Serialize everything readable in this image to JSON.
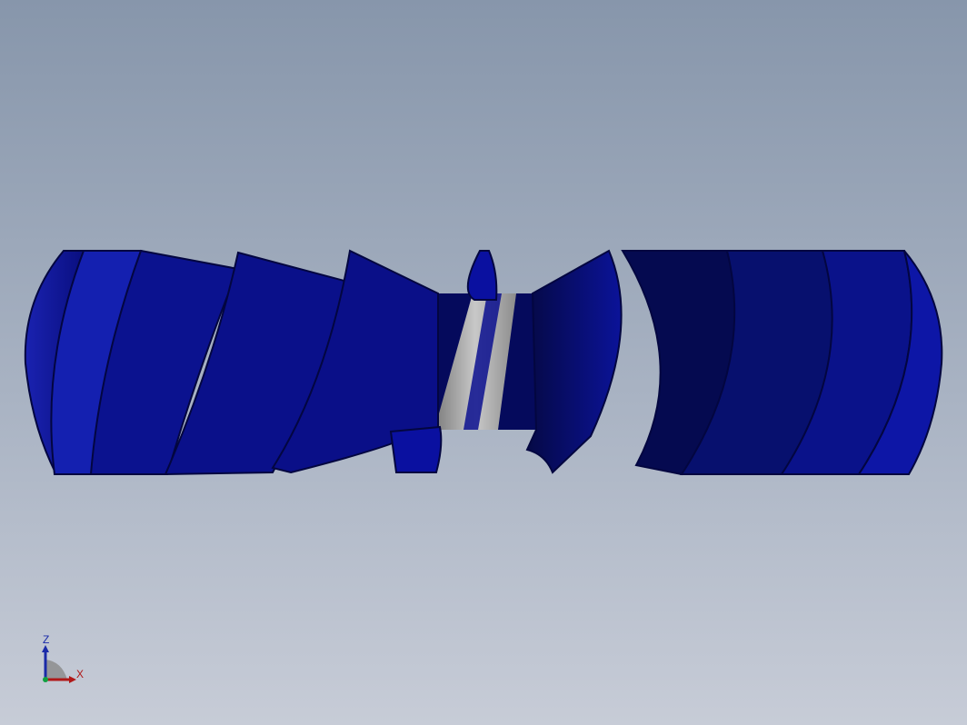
{
  "viewport": {
    "background_top": "#8796ab",
    "background_bottom": "#c7ccd7"
  },
  "model": {
    "description_icon": "helical-screw-conveyor-model",
    "blade_color": "#0a0f8f",
    "blade_dark": "#050a5c",
    "blade_light": "#2a32c0",
    "shaft_color": "#9a9a9a"
  },
  "triad": {
    "z_label": "Z",
    "x_label": "X",
    "z_color": "#1a2aa8",
    "x_color": "#b01818",
    "origin_color": "#10a040"
  }
}
